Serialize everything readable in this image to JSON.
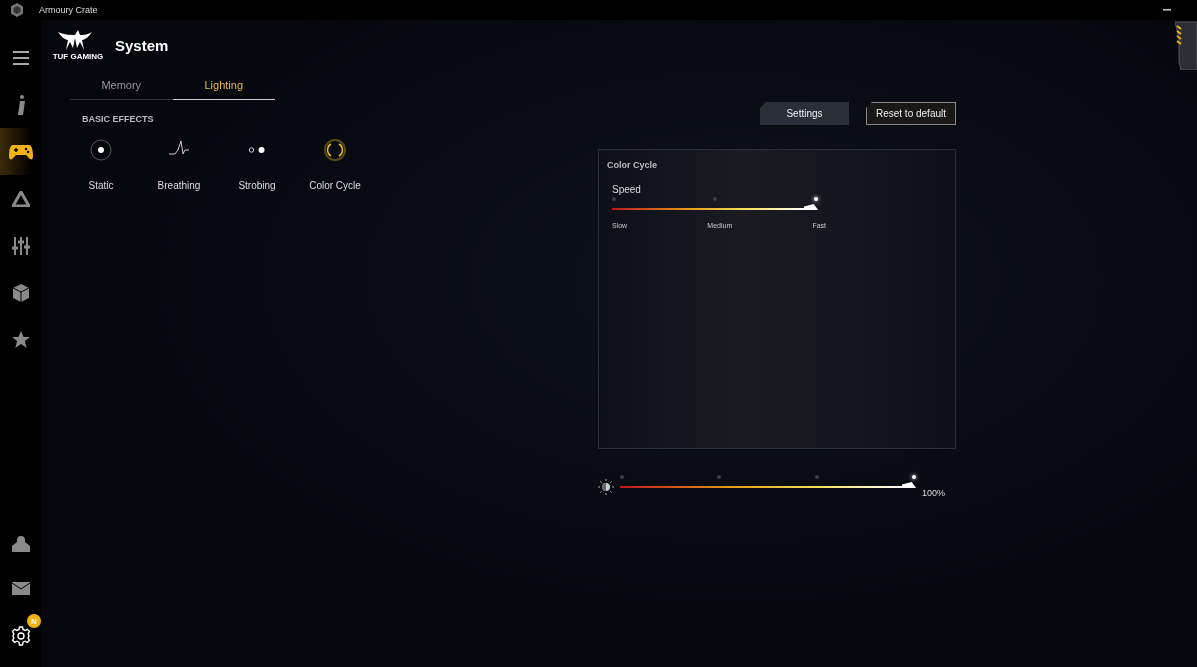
{
  "window": {
    "title": "Armoury Crate"
  },
  "sidebar": {
    "items": [
      {
        "kind": "menu",
        "selected": false
      },
      {
        "kind": "info",
        "selected": false
      },
      {
        "kind": "gamepad",
        "selected": true
      },
      {
        "kind": "triangle",
        "selected": false
      },
      {
        "kind": "sliders",
        "selected": false
      },
      {
        "kind": "cube",
        "selected": false
      },
      {
        "kind": "star",
        "selected": false
      }
    ],
    "bottom_items": [
      {
        "kind": "user",
        "selected": false
      },
      {
        "kind": "mail",
        "selected": false
      },
      {
        "kind": "settings",
        "selected": false,
        "badge": "N"
      }
    ]
  },
  "header": {
    "logo_text": "TUF GAMING",
    "title": "System"
  },
  "tabs": [
    {
      "label": "Memory",
      "selected": false
    },
    {
      "label": "Lighting",
      "selected": true
    }
  ],
  "section_title": "BASIC EFFECTS",
  "effects": [
    {
      "kind": "static",
      "label": "Static",
      "selected": false
    },
    {
      "kind": "breathing",
      "label": "Breathing",
      "selected": false
    },
    {
      "kind": "strobing",
      "label": "Strobing",
      "selected": false
    },
    {
      "kind": "color_cycle",
      "label": "Color Cycle",
      "selected": true
    }
  ],
  "buttons": [
    {
      "label": "Settings",
      "kind": "filled"
    },
    {
      "label": "Reset to default",
      "kind": "outlined"
    }
  ],
  "panel": {
    "title": "Color Cycle",
    "speed": {
      "label": "Speed",
      "level": 1,
      "ticks": [
        "Slow",
        "Medium",
        "Fast"
      ]
    }
  },
  "brightness": {
    "level": 1,
    "reading": "100%"
  }
}
